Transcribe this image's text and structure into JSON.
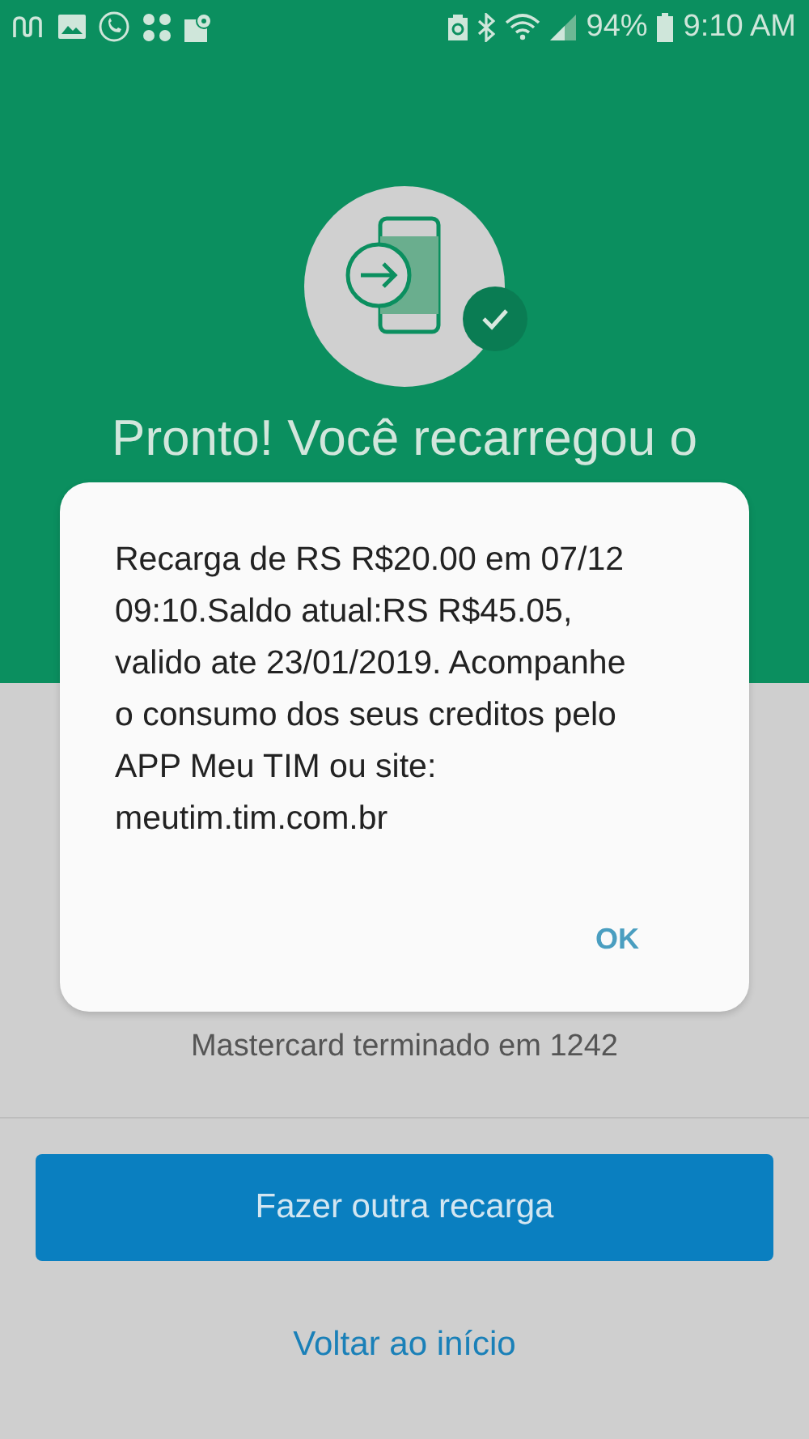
{
  "status_bar": {
    "battery": "94%",
    "time": "9:10 AM"
  },
  "hero": {
    "title": "Pronto! Você recarregou o"
  },
  "payment": {
    "card": "Mastercard terminado em 1242"
  },
  "actions": {
    "primary": "Fazer outra recarga",
    "link": "Voltar ao início"
  },
  "dialog": {
    "message": "Recarga de RS R$20.00 em 07/12 09:10.Saldo atual:RS R$45.05, valido ate 23/01/2019. Acompanhe o consumo dos seus creditos pelo APP Meu TIM ou site: meutim.tim.com.br",
    "button": "OK"
  }
}
